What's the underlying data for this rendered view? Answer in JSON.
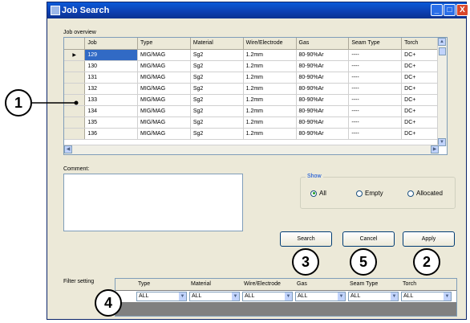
{
  "window": {
    "title": "Job Search",
    "minimize": "_",
    "maximize": "□",
    "close": "X"
  },
  "job_overview": {
    "label": "Job overview",
    "columns": [
      "Job",
      "Type",
      "Material",
      "Wire/Electrode",
      "Gas",
      "Seam Type",
      "Torch"
    ],
    "current_row_marker": "▶",
    "rows": [
      [
        "129",
        "MIG/MAG",
        "Sg2",
        "1.2mm",
        "80-90%Ar",
        "----",
        "DC+"
      ],
      [
        "130",
        "MIG/MAG",
        "Sg2",
        "1.2mm",
        "80-90%Ar",
        "----",
        "DC+"
      ],
      [
        "131",
        "MIG/MAG",
        "Sg2",
        "1.2mm",
        "80-90%Ar",
        "----",
        "DC+"
      ],
      [
        "132",
        "MIG/MAG",
        "Sg2",
        "1.2mm",
        "80-90%Ar",
        "----",
        "DC+"
      ],
      [
        "133",
        "MIG/MAG",
        "Sg2",
        "1.2mm",
        "80-90%Ar",
        "----",
        "DC+"
      ],
      [
        "134",
        "MIG/MAG",
        "Sg2",
        "1.2mm",
        "80-90%Ar",
        "----",
        "DC+"
      ],
      [
        "135",
        "MIG/MAG",
        "Sg2",
        "1.2mm",
        "80-90%Ar",
        "----",
        "DC+"
      ],
      [
        "136",
        "MIG/MAG",
        "Sg2",
        "1.2mm",
        "80-90%Ar",
        "----",
        "DC+"
      ]
    ]
  },
  "comment": {
    "label": "Comment:",
    "value": ""
  },
  "show": {
    "legend": "Show",
    "options": [
      "All",
      "Empty",
      "Allocated"
    ],
    "selected": "All"
  },
  "buttons": {
    "search": "Search",
    "cancel": "Cancel",
    "apply": "Apply"
  },
  "filter": {
    "label": "Filter setting",
    "columns": [
      "Type",
      "Material",
      "Wire/Electrode",
      "Gas",
      "Seam Type",
      "Torch"
    ],
    "values": [
      "ALL",
      "ALL",
      "ALL",
      "ALL",
      "ALL",
      "ALL"
    ]
  },
  "callouts": [
    "1",
    "2",
    "3",
    "4",
    "5"
  ],
  "colors": {
    "title_bar": "#0a4fd0",
    "selection": "#316ac5",
    "close_button": "#d9472b"
  }
}
